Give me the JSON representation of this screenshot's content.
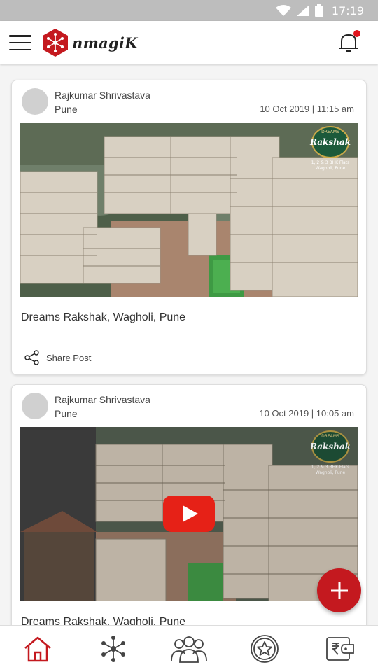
{
  "statusbar": {
    "time": "17:19",
    "icons": [
      "wifi-icon",
      "signal-icon",
      "battery-icon"
    ]
  },
  "appbar": {
    "logo_text": "nmagiK",
    "menu_icon": "hamburger-icon",
    "notification_icon": "bell-icon",
    "has_unread": true
  },
  "colors": {
    "brand": "#c4191f",
    "status_bar": "#bdbdbd",
    "background": "#f4f4f4"
  },
  "posts": [
    {
      "author": "Rajkumar Shrivastava",
      "city": "Pune",
      "datetime": "10 Oct 2019 | 11:15 am",
      "media_type": "image",
      "caption": "Dreams Rakshak, Wagholi, Pune",
      "share_label": "Share Post",
      "badge_top": "DREAMS",
      "badge_name": "Rakshak",
      "badge_line1": "1, 2 & 3 BHK Flats",
      "badge_line2": "Wagholi, Pune"
    },
    {
      "author": "Rajkumar Shrivastava",
      "city": "Pune",
      "datetime": "10 Oct 2019 | 10:05 am",
      "media_type": "video",
      "caption": "Dreams Rakshak, Wagholi, Pune",
      "badge_top": "DREAMS",
      "badge_name": "Rakshak",
      "badge_line1": "1, 2 & 3 BHK Flats",
      "badge_line2": "Wagholi, Pune"
    }
  ],
  "fab": {
    "icon": "plus-icon"
  },
  "bottom_nav": [
    {
      "icon": "home-icon",
      "active": true
    },
    {
      "icon": "network-icon",
      "active": false
    },
    {
      "icon": "people-group-icon",
      "active": false
    },
    {
      "icon": "star-badge-icon",
      "active": false
    },
    {
      "icon": "rupee-wallet-icon",
      "active": false
    }
  ]
}
